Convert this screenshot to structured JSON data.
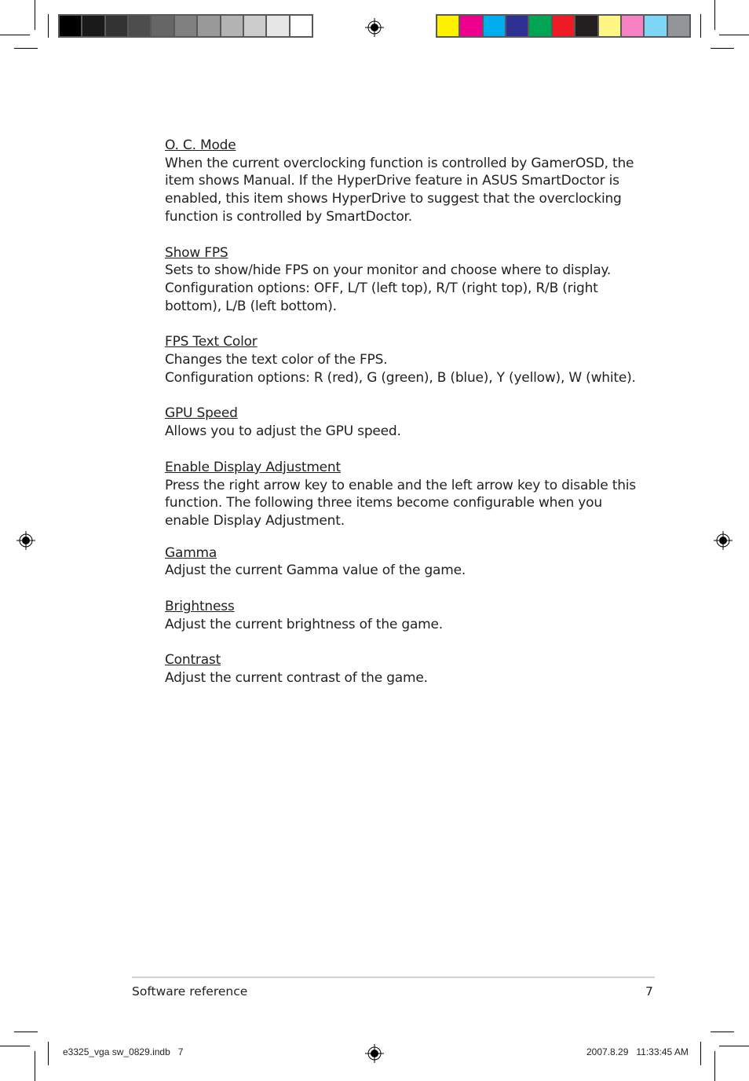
{
  "color_bars": {
    "grayscale": [
      "#000000",
      "#1a1a1a",
      "#333333",
      "#4d4d4d",
      "#666666",
      "#808080",
      "#999999",
      "#b3b3b3",
      "#cccccc",
      "#e6e6e6",
      "#ffffff"
    ],
    "process": [
      "#fff200",
      "#ec008c",
      "#00aeef",
      "#2e3192",
      "#00a651",
      "#ed1c24",
      "#231f20",
      "#fff685",
      "#f682c4",
      "#7dd6f6",
      "#939598"
    ]
  },
  "sections": [
    {
      "heading": "O. C. Mode",
      "paragraphs": [
        "When the current overclocking function is controlled by GamerOSD, the item shows Manual. If the HyperDrive feature in ASUS SmartDoctor is enabled, this item shows HyperDrive to suggest that the overclocking function is controlled by SmartDoctor."
      ]
    },
    {
      "heading": "Show FPS",
      "paragraphs": [
        "Sets to show/hide FPS on your monitor and choose where to display. Configuration options: OFF, L/T (left top), R/T (right top), R/B (right bottom), L/B (left bottom)."
      ]
    },
    {
      "heading": "FPS Text Color",
      "paragraphs": [
        "Changes the text color of the FPS.",
        "Configuration options: R (red), G (green), B (blue), Y (yellow), W (white)."
      ]
    },
    {
      "heading": "GPU Speed",
      "paragraphs": [
        "Allows you to adjust the GPU speed."
      ]
    },
    {
      "heading": "Enable Display Adjustment",
      "paragraphs": [
        "Press the right arrow key to enable and the left arrow key to disable this function. The following three items become configurable when you enable Display Adjustment."
      ]
    },
    {
      "heading": "Gamma",
      "paragraphs": [
        "Adjust the current Gamma value of the game."
      ]
    },
    {
      "heading": "Brightness",
      "paragraphs": [
        "Adjust the current brightness of the game."
      ]
    },
    {
      "heading": "Contrast",
      "paragraphs": [
        "Adjust the current contrast of the game."
      ]
    }
  ],
  "footer": {
    "section_title": "Software reference",
    "page_number": "7"
  },
  "slug": {
    "file_name": "e3325_vga sw_0829.indb   7",
    "timestamp": "2007.8.29   11:33:45 AM"
  }
}
